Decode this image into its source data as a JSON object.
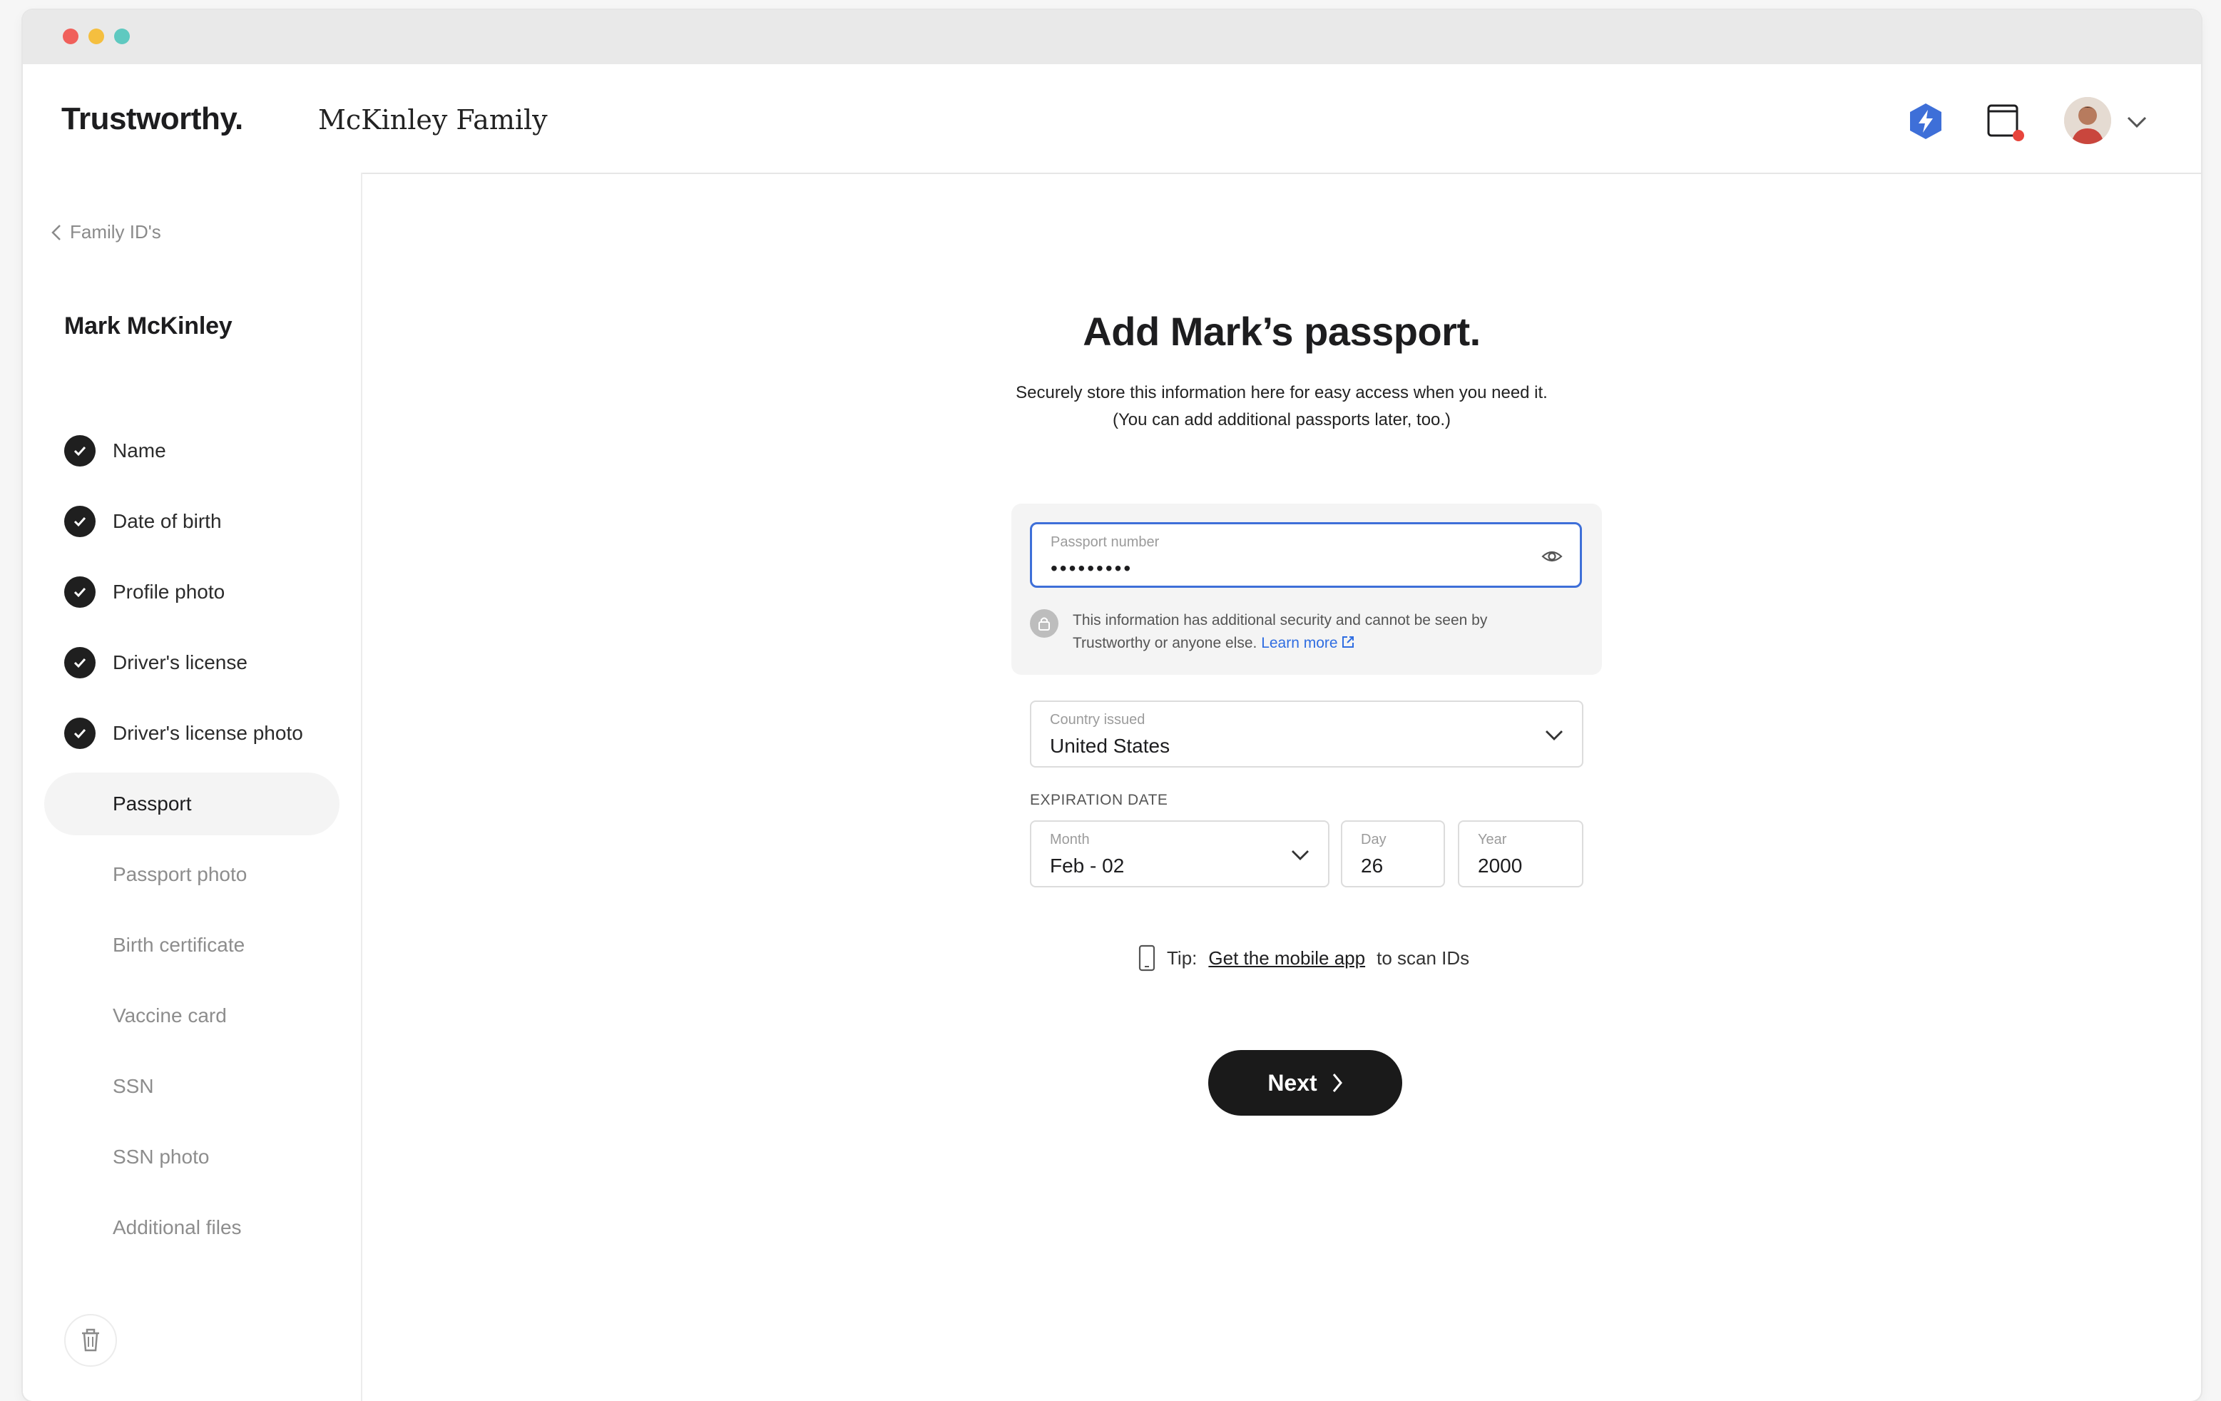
{
  "header": {
    "brand": "Trustworthy.",
    "family_name": "McKinley Family"
  },
  "sidebar": {
    "back_label": "Family ID's",
    "person_name": "Mark McKinley",
    "steps": [
      {
        "label": "Name",
        "status": "complete"
      },
      {
        "label": "Date of birth",
        "status": "complete"
      },
      {
        "label": "Profile photo",
        "status": "complete"
      },
      {
        "label": "Driver's license",
        "status": "complete"
      },
      {
        "label": "Driver's license photo",
        "status": "complete"
      },
      {
        "label": "Passport",
        "status": "active"
      },
      {
        "label": "Passport photo",
        "status": "pending"
      },
      {
        "label": "Birth certificate",
        "status": "pending"
      },
      {
        "label": "Vaccine card",
        "status": "pending"
      },
      {
        "label": "SSN",
        "status": "pending"
      },
      {
        "label": "SSN photo",
        "status": "pending"
      },
      {
        "label": "Additional files",
        "status": "pending"
      }
    ]
  },
  "main": {
    "title": "Add Mark’s passport.",
    "subtitle_line1": "Securely store this information here for easy access when you need it.",
    "subtitle_line2": "(You can add additional passports later, too.)",
    "passport": {
      "label": "Passport number",
      "masked_value": "•••••••••"
    },
    "security_note": "This information has additional security and cannot be seen by Trustworthy or anyone else.",
    "learn_more": "Learn more",
    "country": {
      "label": "Country issued",
      "value": "United States"
    },
    "expiration_label": "EXPIRATION DATE",
    "month": {
      "label": "Month",
      "value": "Feb - 02"
    },
    "day": {
      "label": "Day",
      "value": "26"
    },
    "year": {
      "label": "Year",
      "value": "2000"
    },
    "tip_prefix": "Tip:",
    "tip_link": "Get the mobile app",
    "tip_suffix": "to scan IDs",
    "next_label": "Next"
  },
  "colors": {
    "accent_blue": "#3e6fd8",
    "link_blue": "#2f6de1",
    "button_dark": "#1a1a1a",
    "notification_red": "#e8453c"
  }
}
